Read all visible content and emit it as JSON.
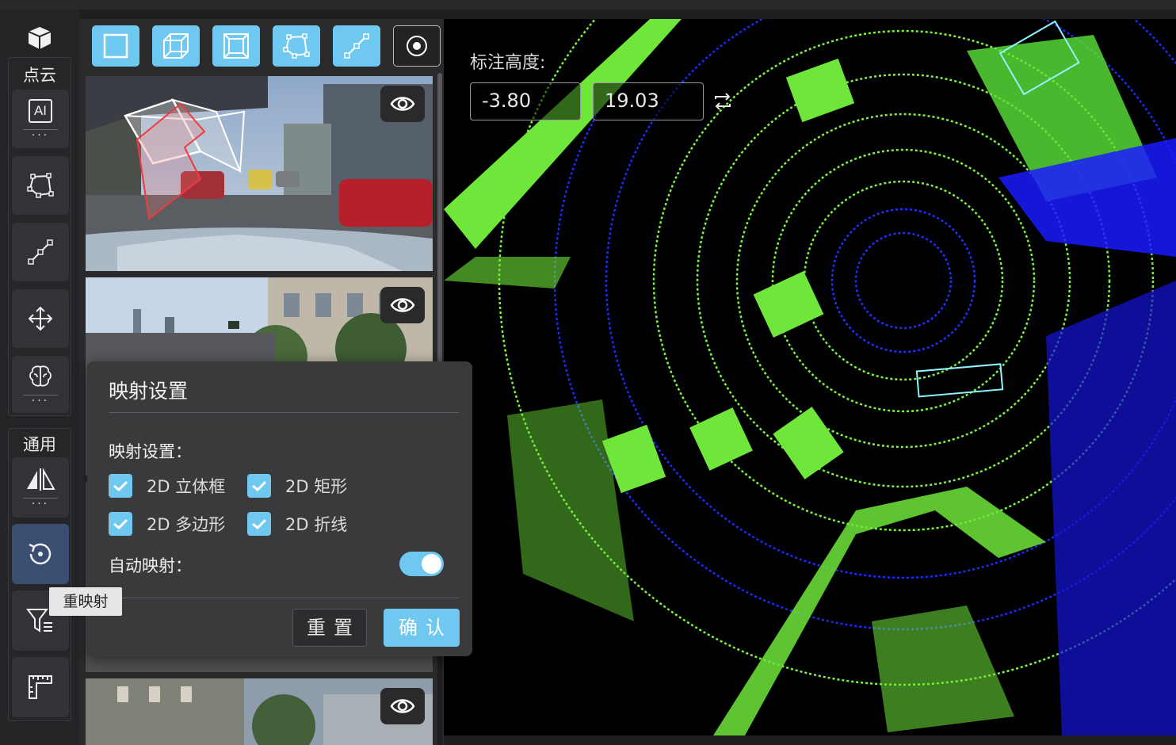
{
  "toolbar": {
    "group_pointcloud_label": "点云",
    "group_general_label": "通用",
    "ai_label": "AI",
    "more_dots": "···",
    "tooltip_remap": "重映射"
  },
  "mode_bar": {
    "icons": [
      "rect-icon",
      "cuboid-icon",
      "cube-icon",
      "polygon-icon",
      "polyline-icon",
      "point-icon"
    ]
  },
  "viewport": {
    "height_label": "标注高度:",
    "height_min": "-3.80",
    "height_max": "19.03"
  },
  "mapping_dialog": {
    "title": "映射设置",
    "section_label": "映射设置：",
    "options": [
      {
        "label": "2D 立体框",
        "checked": true
      },
      {
        "label": "2D 矩形",
        "checked": true
      },
      {
        "label": "2D 多边形",
        "checked": true
      },
      {
        "label": "2D 折线",
        "checked": true
      }
    ],
    "auto_map_label": "自动映射：",
    "auto_map_enabled": true,
    "reset_label": "重置",
    "confirm_label": "确认"
  },
  "colors": {
    "accent": "#6ec8ef",
    "points_near": "#7cf542",
    "points_far": "#1a1aff",
    "active_tool": "#3a4e72"
  }
}
